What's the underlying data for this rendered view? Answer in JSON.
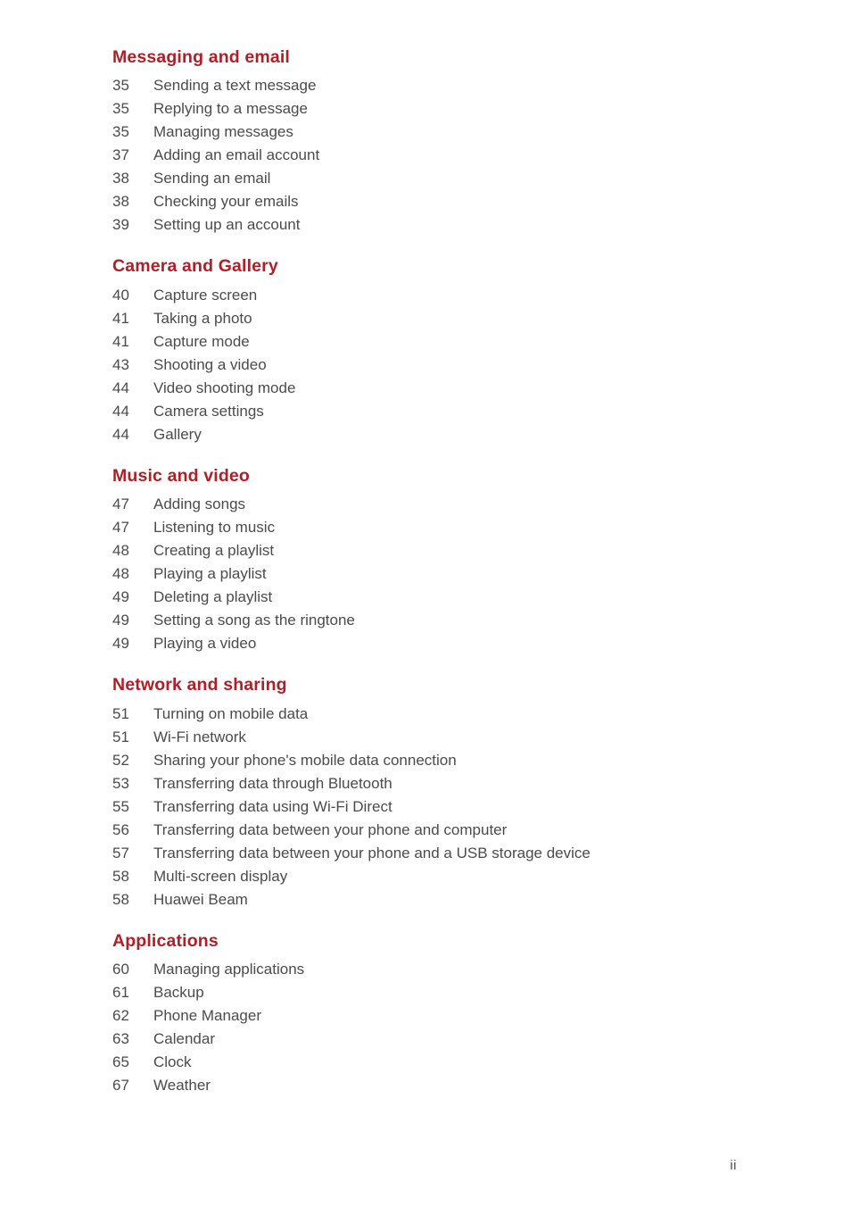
{
  "document": {
    "page_label": "ii",
    "heading_color": "#b01f26",
    "text_color": "#4b4b4b",
    "background_color": "#ffffff"
  },
  "toc": {
    "sections": [
      {
        "title": "Messaging and email",
        "entries": [
          {
            "page": "35",
            "title": "Sending a text message"
          },
          {
            "page": "35",
            "title": "Replying to a message"
          },
          {
            "page": "35",
            "title": "Managing messages"
          },
          {
            "page": "37",
            "title": "Adding an email account"
          },
          {
            "page": "38",
            "title": "Sending an email"
          },
          {
            "page": "38",
            "title": "Checking your emails"
          },
          {
            "page": "39",
            "title": "Setting up an account"
          }
        ]
      },
      {
        "title": "Camera and Gallery",
        "entries": [
          {
            "page": "40",
            "title": "Capture screen"
          },
          {
            "page": "41",
            "title": "Taking a photo"
          },
          {
            "page": "41",
            "title": "Capture mode"
          },
          {
            "page": "43",
            "title": "Shooting a video"
          },
          {
            "page": "44",
            "title": "Video shooting mode"
          },
          {
            "page": "44",
            "title": "Camera settings"
          },
          {
            "page": "44",
            "title": "Gallery"
          }
        ]
      },
      {
        "title": "Music and video",
        "entries": [
          {
            "page": "47",
            "title": "Adding songs"
          },
          {
            "page": "47",
            "title": "Listening to music"
          },
          {
            "page": "48",
            "title": "Creating a playlist"
          },
          {
            "page": "48",
            "title": "Playing a playlist"
          },
          {
            "page": "49",
            "title": "Deleting a playlist"
          },
          {
            "page": "49",
            "title": "Setting a song as the ringtone"
          },
          {
            "page": "49",
            "title": "Playing a video"
          }
        ]
      },
      {
        "title": "Network and sharing",
        "entries": [
          {
            "page": "51",
            "title": "Turning on mobile data"
          },
          {
            "page": "51",
            "title": "Wi-Fi network"
          },
          {
            "page": "52",
            "title": "Sharing your phone's mobile data connection"
          },
          {
            "page": "53",
            "title": "Transferring data through Bluetooth"
          },
          {
            "page": "55",
            "title": "Transferring data using Wi-Fi Direct"
          },
          {
            "page": "56",
            "title": "Transferring data between your phone and computer"
          },
          {
            "page": "57",
            "title": "Transferring data between your phone and a USB storage device"
          },
          {
            "page": "58",
            "title": "Multi-screen display"
          },
          {
            "page": "58",
            "title": "Huawei Beam"
          }
        ]
      },
      {
        "title": "Applications",
        "entries": [
          {
            "page": "60",
            "title": "Managing applications"
          },
          {
            "page": "61",
            "title": "Backup"
          },
          {
            "page": "62",
            "title": "Phone Manager"
          },
          {
            "page": "63",
            "title": "Calendar"
          },
          {
            "page": "65",
            "title": "Clock"
          },
          {
            "page": "67",
            "title": "Weather"
          }
        ]
      }
    ]
  }
}
